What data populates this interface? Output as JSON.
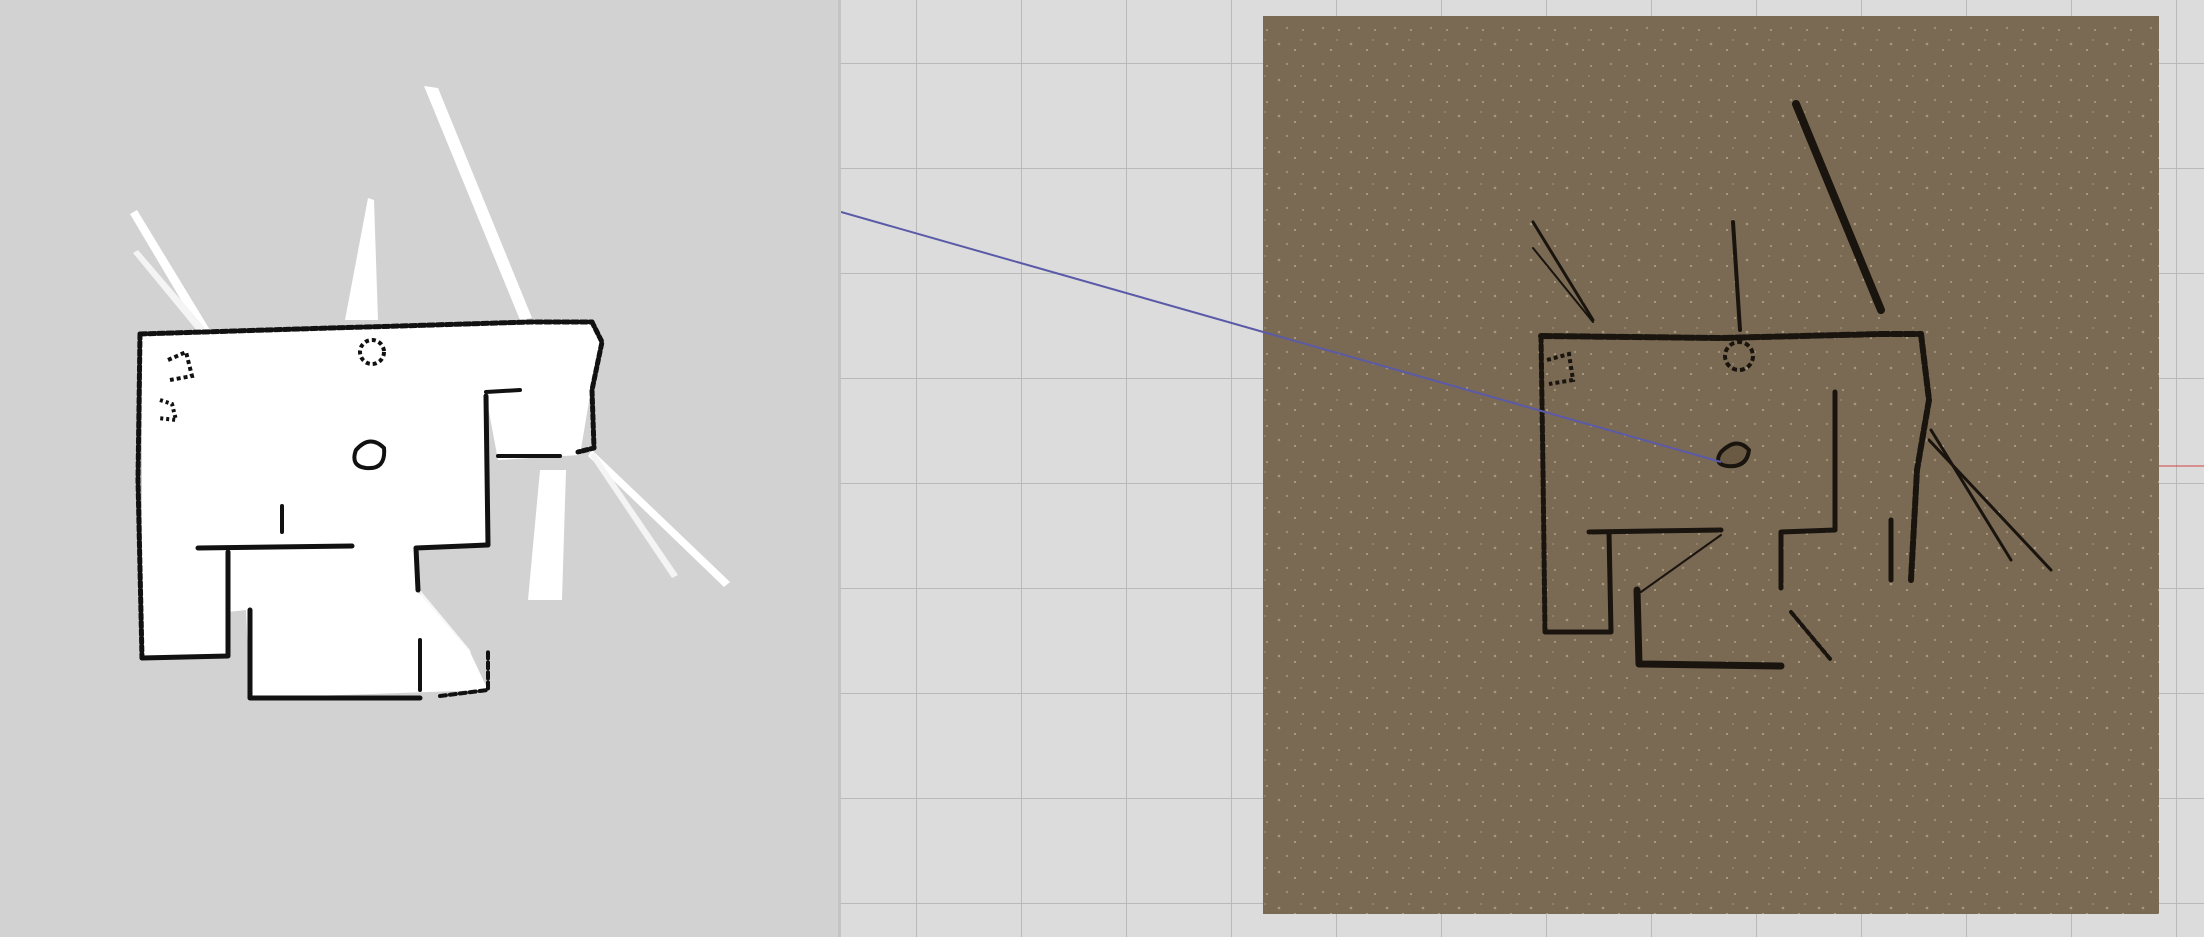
{
  "views": {
    "left": {
      "name": "occupancy-map-view",
      "background": "#d2d2d2",
      "free_space_color": "#ffffff",
      "obstacle_color": "#111111"
    },
    "right": {
      "name": "world-3d-view",
      "grid_background": "#dcdcdc",
      "grid_line_color": "#b8b8b8",
      "ground_color": "#7a6a54",
      "wall_color": "#1a140e",
      "marker_line_color": "#5a5aa8"
    }
  }
}
